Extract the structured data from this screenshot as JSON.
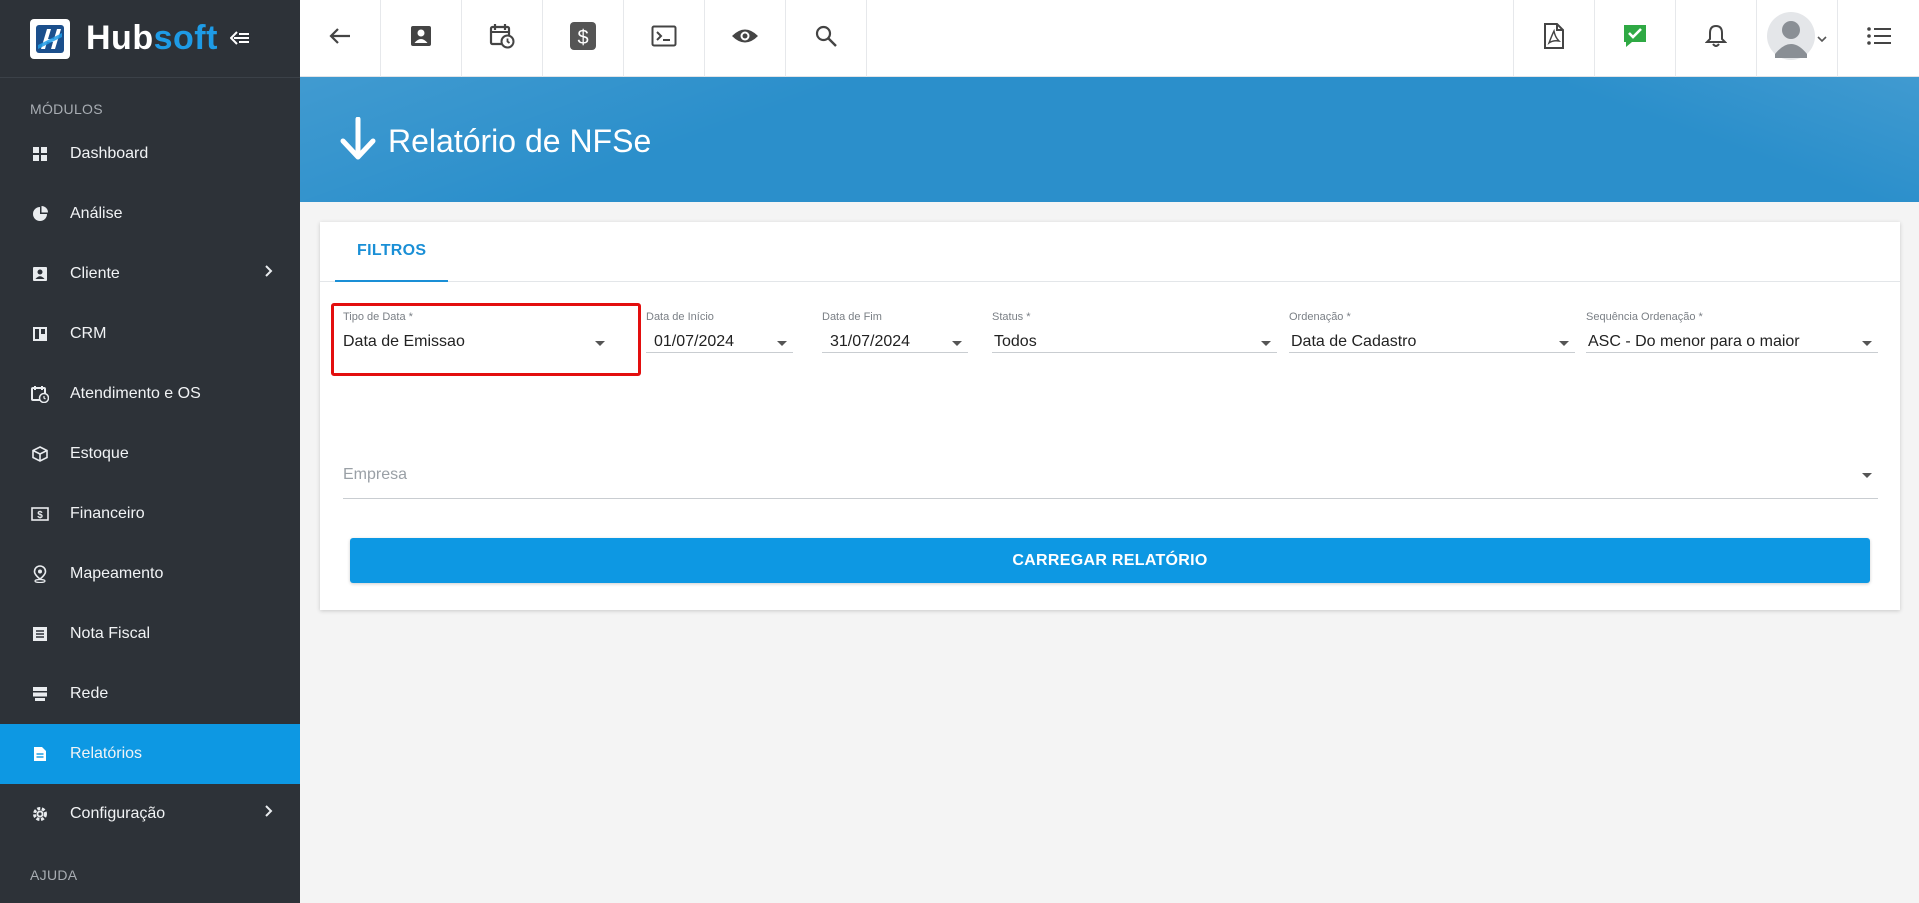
{
  "brand": {
    "name_part1": "Hub",
    "name_part2": "soft",
    "accent": "#1e9be6"
  },
  "sidebar": {
    "section_modules": "MÓDULOS",
    "section_help": "AJUDA",
    "items": [
      {
        "label": "Dashboard",
        "icon": "dashboard-icon"
      },
      {
        "label": "Análise",
        "icon": "pie-chart-icon"
      },
      {
        "label": "Cliente",
        "icon": "contact-card-icon",
        "has_submenu": true
      },
      {
        "label": "CRM",
        "icon": "crm-board-icon"
      },
      {
        "label": "Atendimento e OS",
        "icon": "calendar-clock-icon"
      },
      {
        "label": "Estoque",
        "icon": "box-icon"
      },
      {
        "label": "Financeiro",
        "icon": "money-icon"
      },
      {
        "label": "Mapeamento",
        "icon": "map-pin-icon"
      },
      {
        "label": "Nota Fiscal",
        "icon": "invoice-icon"
      },
      {
        "label": "Rede",
        "icon": "server-icon"
      },
      {
        "label": "Relatórios",
        "icon": "report-icon",
        "active": true
      },
      {
        "label": "Configuração",
        "icon": "gear-icon",
        "has_submenu": true
      }
    ],
    "active_color": "#0d98e3"
  },
  "topbar": {
    "icons": [
      "back-arrow-icon",
      "contact-card-icon",
      "calendar-clock-icon",
      "dollar-icon",
      "terminal-icon",
      "eye-icon",
      "search-icon",
      "pdf-icon",
      "check-chat-icon",
      "bell-icon",
      "avatar",
      "list-menu-icon"
    ]
  },
  "banner": {
    "title": "Relatório de NFSe"
  },
  "tabs": {
    "filters": "FILTROS"
  },
  "filters": {
    "tipo_data": {
      "label": "Tipo de Data *",
      "value": "Data de Emissao"
    },
    "data_inicio": {
      "label": "Data de Início",
      "value": "01/07/2024"
    },
    "data_fim": {
      "label": "Data de Fim",
      "value": "31/07/2024"
    },
    "status": {
      "label": "Status *",
      "value": "Todos"
    },
    "ordenacao": {
      "label": "Ordenação *",
      "value": "Data de Cadastro"
    },
    "sequencia": {
      "label": "Sequência Ordenação *",
      "value": "ASC - Do menor para o maior"
    },
    "empresa": {
      "placeholder": "Empresa"
    }
  },
  "actions": {
    "load_report": "CARREGAR RELATÓRIO"
  }
}
